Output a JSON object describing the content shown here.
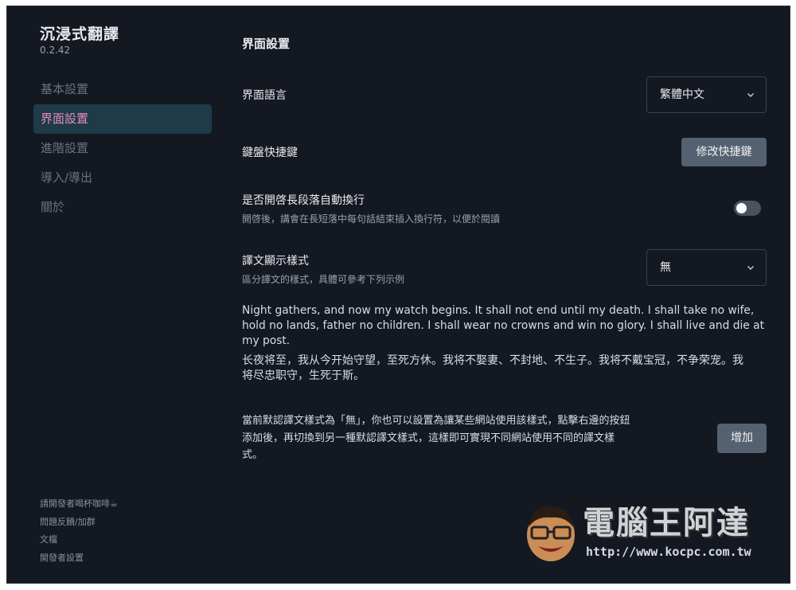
{
  "app": {
    "title": "沉浸式翻譯",
    "version": "0.2.42"
  },
  "sidebar": {
    "items": [
      {
        "label": "基本設置",
        "active": false
      },
      {
        "label": "界面設置",
        "active": true
      },
      {
        "label": "進階設置",
        "active": false
      },
      {
        "label": "導入/導出",
        "active": false
      },
      {
        "label": "關於",
        "active": false
      }
    ],
    "footer": [
      "請開發者喝杯咖啡☕",
      "問題反饋/加群",
      "文檔",
      "開發者設置"
    ]
  },
  "main": {
    "section_title": "界面設置",
    "ui_language": {
      "label": "界面語言",
      "value": "繁體中文"
    },
    "shortcuts": {
      "label": "鍵盤快捷鍵",
      "button": "修改快捷鍵"
    },
    "auto_wrap": {
      "label": "是否開啓長段落自動換行",
      "description": "開啓後，講會在長短落中每句話結束插入換行符，以便於閱讀",
      "enabled": false
    },
    "translation_style": {
      "label": "譯文顯示樣式",
      "description": "區分譯文的樣式，具體可參考下列示例",
      "value": "無"
    },
    "example_en": "Night gathers, and now my watch begins. It shall not end until my death. I shall take no wife, hold no lands, father no children. I shall wear no crowns and win no glory. I shall live and die at my post.",
    "example_zh": "长夜将至，我从今开始守望，至死方休。我将不娶妻、不封地、不生子。我将不戴宝冠，不争荣宠。我将尽忠职守，生死于斯。",
    "note": "當前默認譯文樣式為「無」，你也可以設置為讓某些網站使用該樣式，點擊右邊的按鈕添加後，再切換到另一種默認譯文樣式，這樣即可實現不同網站使用不同的譯文樣式。",
    "add_button": "增加"
  },
  "watermark": {
    "name": "電腦王阿達",
    "url": "http://www.kocpc.com.tw"
  },
  "colors": {
    "background": "#141821",
    "active_nav_bg": "#1f3a48",
    "active_nav_text": "#e58dbd",
    "button": "#546170"
  }
}
